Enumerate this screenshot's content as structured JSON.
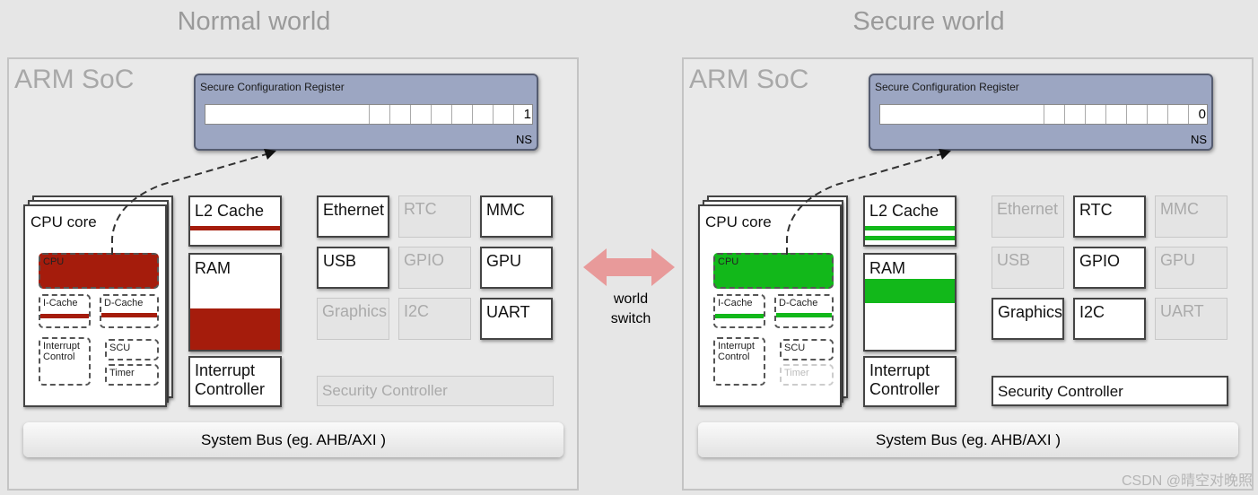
{
  "colors": {
    "normal_accent": "#a51c0c",
    "secure_accent": "#12b81a",
    "register_fill": "#9ca6c2"
  },
  "worlds": [
    {
      "title": "Normal world",
      "soc_label": "ARM SoC",
      "register_title": "Secure Configuration Register",
      "ns_bit": "1",
      "ns_label": "NS",
      "accent": "#a51c0c",
      "cpu_core": "CPU core",
      "cpu": "CPU",
      "icache": "I-Cache",
      "dcache": "D-Cache",
      "interrupt_control": "Interrupt Control",
      "scu": "SCU",
      "timer": "Timer",
      "timer_active": true,
      "l2": "L2 Cache",
      "ram": "RAM",
      "interrupt_controller": "Interrupt Controller",
      "peripherals": [
        {
          "label": "Ethernet",
          "active": true
        },
        {
          "label": "RTC",
          "active": false
        },
        {
          "label": "MMC",
          "active": true
        },
        {
          "label": "USB",
          "active": true
        },
        {
          "label": "GPIO",
          "active": false
        },
        {
          "label": "GPU",
          "active": true
        },
        {
          "label": "Graphics",
          "active": false
        },
        {
          "label": "I2C",
          "active": false
        },
        {
          "label": "UART",
          "active": true
        }
      ],
      "security_controller": "Security Controller",
      "security_controller_active": false,
      "bus": "System Bus (eg. AHB/AXI )"
    },
    {
      "title": "Secure world",
      "soc_label": "ARM SoC",
      "register_title": "Secure Configuration Register",
      "ns_bit": "0",
      "ns_label": "NS",
      "accent": "#12b81a",
      "cpu_core": "CPU core",
      "cpu": "CPU",
      "icache": "I-Cache",
      "dcache": "D-Cache",
      "interrupt_control": "Interrupt Control",
      "scu": "SCU",
      "timer": "Timer",
      "timer_active": false,
      "l2": "L2 Cache",
      "ram": "RAM",
      "interrupt_controller": "Interrupt Controller",
      "peripherals": [
        {
          "label": "Ethernet",
          "active": false
        },
        {
          "label": "RTC",
          "active": true
        },
        {
          "label": "MMC",
          "active": false
        },
        {
          "label": "USB",
          "active": false
        },
        {
          "label": "GPIO",
          "active": true
        },
        {
          "label": "GPU",
          "active": false
        },
        {
          "label": "Graphics",
          "active": true
        },
        {
          "label": "I2C",
          "active": true
        },
        {
          "label": "UART",
          "active": false
        }
      ],
      "security_controller": "Security Controller",
      "security_controller_active": true,
      "bus": "System Bus (eg. AHB/AXI )"
    }
  ],
  "switch": {
    "line1": "world",
    "line2": "switch",
    "arrow_icon": "double-arrow-icon"
  },
  "watermark": "CSDN @晴空对晚照"
}
